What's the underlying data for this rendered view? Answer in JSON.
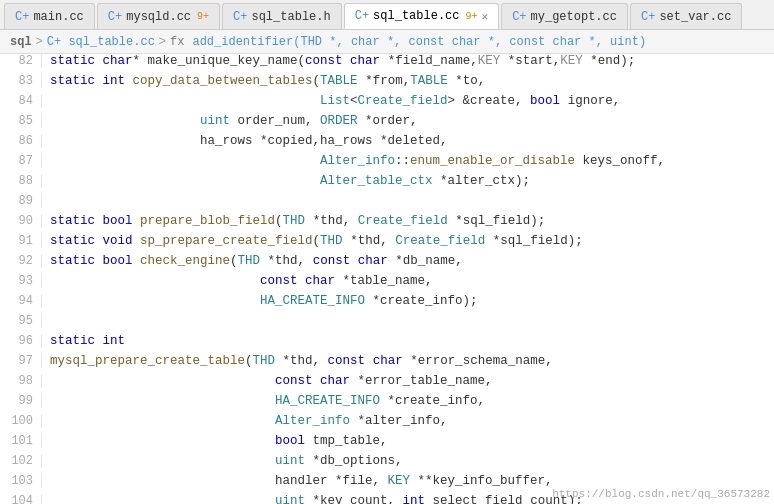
{
  "tabs": [
    {
      "id": "main-cc",
      "label": "main.cc",
      "icon": "C+",
      "active": false,
      "modified": false,
      "closable": false
    },
    {
      "id": "mysqld-cc",
      "label": "mysqld.cc",
      "icon": "C+",
      "active": false,
      "modified": true,
      "closable": false,
      "badge": "9+"
    },
    {
      "id": "sql-table-h",
      "label": "sql_table.h",
      "icon": "C+",
      "active": false,
      "modified": false,
      "closable": false
    },
    {
      "id": "sql-table-cc",
      "label": "sql_table.cc",
      "icon": "C+",
      "active": true,
      "modified": true,
      "closable": true,
      "badge": "9+"
    },
    {
      "id": "my-getopt-cc",
      "label": "my_getopt.cc",
      "icon": "C+",
      "active": false,
      "modified": false,
      "closable": false
    },
    {
      "id": "set-var-cc",
      "label": "set_var.cc",
      "icon": "C+",
      "active": false,
      "modified": false,
      "closable": false
    }
  ],
  "breadcrumb": {
    "root": "sql",
    "file": "sql_table.cc",
    "func_prefix": "fx",
    "func": "add_identifier(THD *, char *, const char *, const char *, uint)"
  },
  "watermark": "https://blog.csdn.net/qq_36573282"
}
